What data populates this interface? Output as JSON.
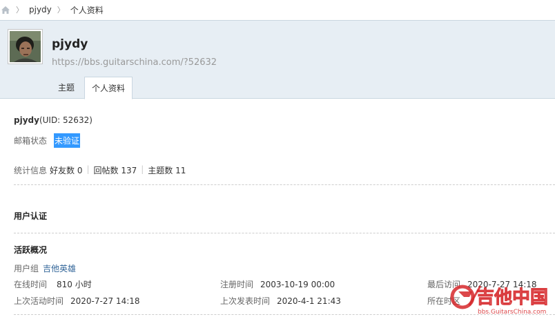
{
  "breadcrumb": {
    "user": "pjydy",
    "page": "个人资料"
  },
  "profile": {
    "username": "pjydy",
    "url": "https://bbs.guitarschina.com/?52632",
    "tabs": [
      {
        "label": "主题"
      },
      {
        "label": "个人资料"
      }
    ]
  },
  "info": {
    "name": "pjydy",
    "uid_text": "(UID: 52632)",
    "email_label": "邮箱状态",
    "email_value": "未验证",
    "stats_label": "统计信息",
    "friends": "好友数 0",
    "replies": "回帖数 137",
    "threads": "主题数 11"
  },
  "sections": {
    "auth_title": "用户认证",
    "activity_title": "活跃概况"
  },
  "activity": {
    "group_label": "用户组",
    "group_value": "吉他英雄",
    "online_label": "在线时间",
    "online_value": "810 小时",
    "register_label": "注册时间",
    "register_value": "2003-10-19 00:00",
    "lastvisit_label": "最后访问",
    "lastvisit_value": "2020-7-27 14:18",
    "lastactive_label": "上次活动时间",
    "lastactive_value": "2020-7-27 14:18",
    "lastpost_label": "上次发表时间",
    "lastpost_value": "2020-4-1 21:43",
    "zone_label": "所在时区"
  },
  "watermark": {
    "brand": "吉他中国",
    "url": "bbs.GuitarsChina.com"
  },
  "colors": {
    "header_bg": "#e7eef4",
    "link": "#336699",
    "highlight": "#3399ff",
    "watermark_red": "#d6282b"
  }
}
